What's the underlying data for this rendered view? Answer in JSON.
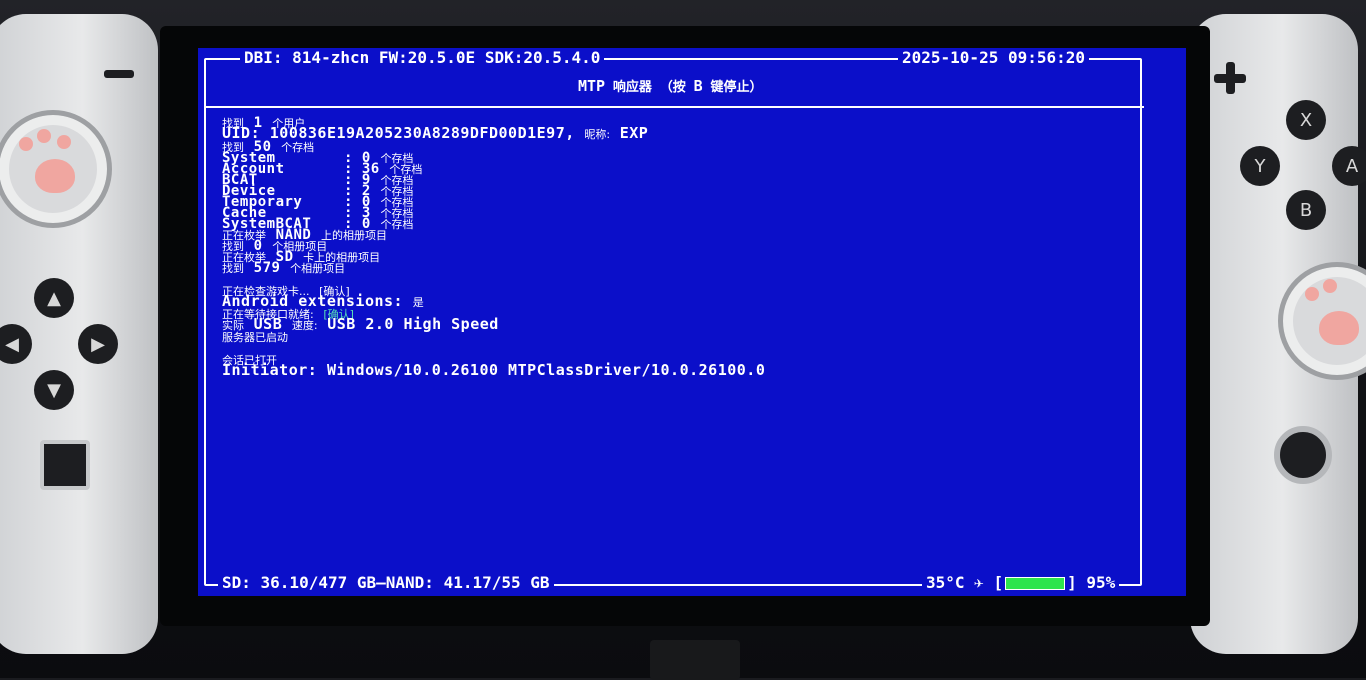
{
  "header": {
    "left": "DBI: 814-zhcn FW:20.5.0E SDK:20.5.4.0",
    "datetime": "2025-10-25 09:56:20",
    "mode_prefix": "MTP",
    "mode_mid_cn": "响应器 （按",
    "mode_key": "B",
    "mode_suffix_cn": "键停止）"
  },
  "log": {
    "found_users_prefix": "找到",
    "found_users_count": "1",
    "found_users_suffix": "个用户",
    "uid_label": "UID:",
    "uid_value": "100836E19A205230A8289DFD00D1E97,",
    "nickname_label": "昵称:",
    "nickname_value": "EXP",
    "found_saves_prefix": "找到",
    "found_saves_count": "50",
    "found_saves_suffix": "个存档",
    "save_types": [
      {
        "name": "System",
        "count": "0",
        "unit": "个存档"
      },
      {
        "name": "Account",
        "count": "36",
        "unit": "个存档"
      },
      {
        "name": "BCAT",
        "count": "9",
        "unit": "个存档"
      },
      {
        "name": "Device",
        "count": "2",
        "unit": "个存档"
      },
      {
        "name": "Temporary",
        "count": "0",
        "unit": "个存档"
      },
      {
        "name": "Cache",
        "count": "3",
        "unit": "个存档"
      },
      {
        "name": "SystemBCAT",
        "count": "0",
        "unit": "个存档"
      }
    ],
    "enum_nand_prefix": "正在枚举",
    "enum_nand_target": "NAND",
    "enum_nand_suffix": "上的相册项目",
    "found_nand_album_prefix": "找到",
    "found_nand_album_count": "0",
    "found_nand_album_suffix": "个相册项目",
    "enum_sd_prefix": "正在枚举",
    "enum_sd_target": "SD",
    "enum_sd_suffix": "卡上的相册项目",
    "found_sd_album_prefix": "找到",
    "found_sd_album_count": "579",
    "found_sd_album_suffix": "个相册项目",
    "check_card": "正在检查游戏卡...",
    "check_card_status": "[确认]",
    "android_ext_label": "Android extensions:",
    "android_ext_value": "是",
    "waiting_port": "正在等待接口就绪:",
    "waiting_port_status": "[确认]",
    "actual_prefix": "实际",
    "actual_usb": "USB",
    "actual_speed_label": "速度:",
    "actual_speed_value": "USB 2.0 High Speed",
    "server_started": "服务器已启动",
    "session_opened": "会话已打开",
    "initiator_label": "Initiator:",
    "initiator_value": "Windows/10.0.26100 MTPClassDriver/10.0.26100.0"
  },
  "footer": {
    "sd": "SD: 36.10/477 GB",
    "nand": "NAND: 41.17/55 GB",
    "temp": "35°C",
    "airplane_icon": "✈",
    "battery_icon_level": "1",
    "battery_percent": "95%"
  },
  "colors": {
    "screen_bg": "#0b0fc9",
    "text": "#ffffff",
    "ok_green": "#58e0b6",
    "battery": "#2ee44d"
  }
}
